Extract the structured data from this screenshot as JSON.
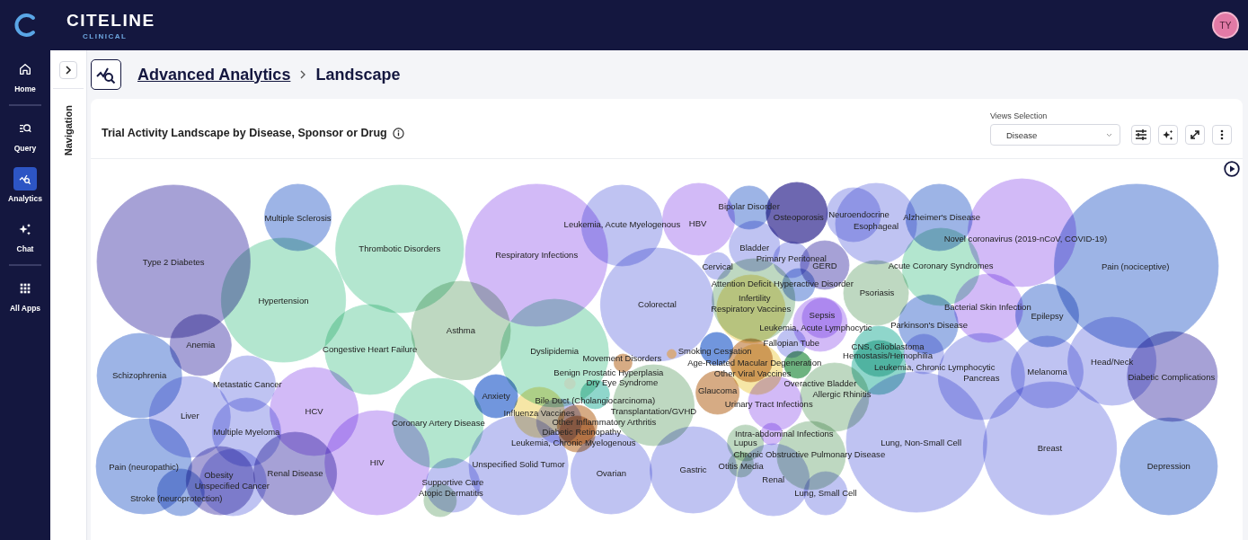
{
  "header": {
    "logo": "CITELINE",
    "logo_subtitle": "CLINICAL",
    "avatar": "TY"
  },
  "rail": [
    {
      "label": "Home",
      "selected": false
    },
    {
      "label": "Query",
      "selected": false
    },
    {
      "label": "Analytics",
      "selected": true
    },
    {
      "label": "Chat",
      "selected": false
    },
    {
      "label": "All Apps",
      "selected": false
    }
  ],
  "navigation_panel": {
    "label": "Navigation"
  },
  "breadcrumb": [
    {
      "label": "Advanced Analytics"
    },
    {
      "label": "Landscape"
    }
  ],
  "card": {
    "title": "Trial Activity Landscape by Disease, Sponsor or Drug",
    "views_selection": {
      "label": "Views Selection",
      "value": "Disease"
    },
    "bubbles": [
      {
        "label": "Type 2 Diabetes",
        "color": "#a6a1d6"
      },
      {
        "label": "Multiple Sclerosis",
        "color": "#9db4e6"
      },
      {
        "label": "Thrombotic Disorders",
        "color": "#b3e6cf"
      },
      {
        "label": "Respiratory Infections",
        "color": "#d2baf7"
      },
      {
        "label": "Leukemia, Acute Myelogenous",
        "color": "#bfc3f2"
      },
      {
        "label": "HBV",
        "color": "#d2baf7"
      },
      {
        "label": "Bipolar Disorder",
        "color": "#9db4e6"
      },
      {
        "label": "Osteoporosis",
        "color": "#6d67b0"
      },
      {
        "label": "Neuroendocrine",
        "color": "#bfc3f2"
      },
      {
        "label": "Esophageal",
        "color": "#bfc3f2"
      },
      {
        "label": "Alzheimer's Disease",
        "color": "#9db4e6"
      },
      {
        "label": "Novel coronavirus (2019-nCoV, COVID-19)",
        "color": "#d2baf7"
      },
      {
        "label": "Pain (nociceptive)",
        "color": "#9db4e6"
      },
      {
        "label": "Hypertension",
        "color": "#b3e6cf"
      },
      {
        "label": "Anemia",
        "color": "#a6a1d6"
      },
      {
        "label": "Congestive Heart Failure",
        "color": "#b3e6cf"
      },
      {
        "label": "Asthma",
        "color": "#bed8c1"
      },
      {
        "label": "Dyslipidemia",
        "color": "#b3e6cf"
      },
      {
        "label": "Colorectal",
        "color": "#bfc3f2"
      },
      {
        "label": "Bladder",
        "color": "#bfc3f2"
      },
      {
        "label": "Cervical",
        "color": "#bfc3f2"
      },
      {
        "label": "Primary Peritoneal",
        "color": "#bfc3f2"
      },
      {
        "label": "GERD",
        "color": "#a6a1d6"
      },
      {
        "label": "Acute Coronary Syndromes",
        "color": "#b3e6cf"
      },
      {
        "label": "Attention Deficit Hyperactive Disorder",
        "color": "#9db4e6"
      },
      {
        "label": "Infertility",
        "color": "#bed8c1"
      },
      {
        "label": "Respiratory Vaccines",
        "color": "#f6e6a6"
      },
      {
        "label": "Psoriasis",
        "color": "#bed8c1"
      },
      {
        "label": "Sepsis",
        "color": "#d2baf7"
      },
      {
        "label": "Leukemia, Acute Lymphocytic",
        "color": "#d2baf7"
      },
      {
        "label": "Parkinson's Disease",
        "color": "#9db4e6"
      },
      {
        "label": "Bacterial Skin Infection",
        "color": "#d2baf7"
      },
      {
        "label": "Epilepsy",
        "color": "#9db4e6"
      },
      {
        "label": "Fallopian Tube",
        "color": "#bfc3f2"
      },
      {
        "label": "Smoking Cessation",
        "color": "#7196dd"
      },
      {
        "label": "Movement Disorders",
        "color": "#d6ab84"
      },
      {
        "label": "Benign Prostatic Hyperplasia",
        "color": "#bed8c1"
      },
      {
        "label": "Dry Eye Syndrome",
        "color": "#d6ab84"
      },
      {
        "label": "Age-Related Macular Degeneration",
        "color": "#d6ab84"
      },
      {
        "label": "Other Viral Vaccines",
        "color": "#f6e6a6"
      },
      {
        "label": "Overactive Bladder",
        "color": "#6db27f"
      },
      {
        "label": "CNS, Glioblastoma",
        "color": "#8fd6cb"
      },
      {
        "label": "Hemostasis/Hemophilia",
        "color": "#bfc3f2"
      },
      {
        "label": "Leukemia, Chronic Lymphocytic",
        "color": "#8fd6cb"
      },
      {
        "label": "Pancreas",
        "color": "#bfc3f2"
      },
      {
        "label": "Melanoma",
        "color": "#bfc3f2"
      },
      {
        "label": "Head/Neck",
        "color": "#bfc3f2"
      },
      {
        "label": "Diabetic Complications",
        "color": "#a6a1d6"
      },
      {
        "label": "Glaucoma",
        "color": "#d6ab84"
      },
      {
        "label": "Urinary Tract Infections",
        "color": "#d2baf7"
      },
      {
        "label": "Allergic Rhinitis",
        "color": "#bed8c1"
      },
      {
        "label": "Transplantation/GVHD",
        "color": "#bed8c1"
      },
      {
        "label": "Anxiety",
        "color": "#7196dd"
      },
      {
        "label": "Bile Duct (Cholangiocarcinoma)",
        "color": "#8fd6cb"
      },
      {
        "label": "Influenza Vaccines",
        "color": "#f6e6a6"
      },
      {
        "label": "Other Inflammatory Arthritis",
        "color": "#d6ab84"
      },
      {
        "label": "Diabetic Retinopathy",
        "color": "#d6ab84"
      },
      {
        "label": "Leukemia, Chronic Myelogenous",
        "color": "#bfc3f2"
      },
      {
        "label": "Coronary Artery Disease",
        "color": "#b3e6cf"
      },
      {
        "label": "HCV",
        "color": "#d2baf7"
      },
      {
        "label": "Schizophrenia",
        "color": "#9db4e6"
      },
      {
        "label": "Metastatic Cancer",
        "color": "#bfc3f2"
      },
      {
        "label": "Liver",
        "color": "#bfc3f2"
      },
      {
        "label": "Multiple Myeloma",
        "color": "#bfc3f2"
      },
      {
        "label": "HIV",
        "color": "#d2baf7"
      },
      {
        "label": "Pain (neuropathic)",
        "color": "#9db4e6"
      },
      {
        "label": "Obesity",
        "color": "#a6a1d6"
      },
      {
        "label": "Stroke (neuroprotection)",
        "color": "#9db4e6"
      },
      {
        "label": "Unspecified Cancer",
        "color": "#bfc3f2"
      },
      {
        "label": "Renal Disease",
        "color": "#a6a1d6"
      },
      {
        "label": "Supportive Care",
        "color": "#bfc3f2"
      },
      {
        "label": "Atopic Dermatitis",
        "color": "#bed8c1"
      },
      {
        "label": "Unspecified Solid Tumor",
        "color": "#bfc3f2"
      },
      {
        "label": "Ovarian",
        "color": "#bfc3f2"
      },
      {
        "label": "Gastric",
        "color": "#bfc3f2"
      },
      {
        "label": "Intra-abdominal Infections",
        "color": "#d2baf7"
      },
      {
        "label": "Lupus",
        "color": "#bed8c1"
      },
      {
        "label": "Chronic Obstructive Pulmonary Disease",
        "color": "#bed8c1"
      },
      {
        "label": "Otitis Media",
        "color": "#bed8c1"
      },
      {
        "label": "Renal",
        "color": "#bfc3f2"
      },
      {
        "label": "Lung, Small Cell",
        "color": "#bfc3f2"
      },
      {
        "label": "Lung, Non-Small Cell",
        "color": "#bfc3f2"
      },
      {
        "label": "Breast",
        "color": "#bfc3f2"
      },
      {
        "label": "Depression",
        "color": "#9db4e6"
      }
    ]
  }
}
